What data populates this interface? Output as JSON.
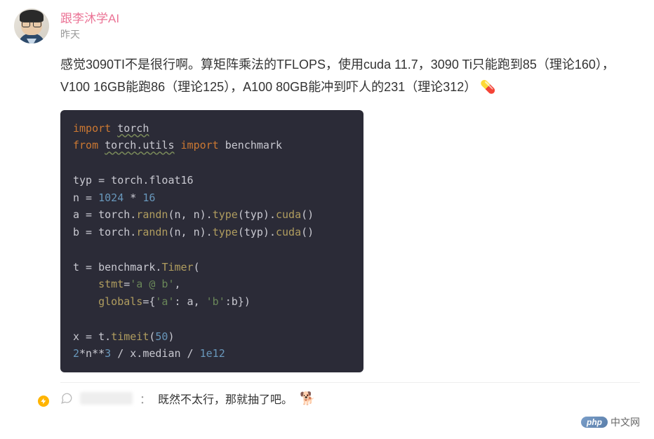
{
  "author": {
    "name": "跟李沐学AI",
    "badge": "verified"
  },
  "timestamp": "昨天",
  "post_text": "感觉3090TI不是很行啊。算矩阵乘法的TFLOPS，使用cuda 11.7，3090 Ti只能跑到85（理论160），V100 16GB能跑86（理论125），A100 80GB能冲到吓人的231（理论312）",
  "pill_emoji": "💊",
  "code": {
    "line1_kw1": "import",
    "line1_mod": "torch",
    "line2_kw1": "from",
    "line2_mod": "torch.utils",
    "line2_kw2": "import",
    "line2_name": "benchmark",
    "line4_var": "typ = torch.float16",
    "line5": "n = ",
    "line5_num1": "1024",
    "line5_op": " * ",
    "line5_num2": "16",
    "line6_pre": "a = torch.",
    "line6_fn": "randn",
    "line6_args": "(n, n).",
    "line6_fn2": "type",
    "line6_args2": "(typ).",
    "line6_fn3": "cuda",
    "line6_end": "()",
    "line7_pre": "b = torch.",
    "line9_pre": "t = benchmark.",
    "line9_fn": "Timer",
    "line9_par": "(",
    "line10_indent": "    ",
    "line10_key": "stmt",
    "line10_eq": "=",
    "line10_str": "'a @ b'",
    "line10_comma": ",",
    "line11_key": "globals",
    "line11_eq": "={",
    "line11_str1": "'a'",
    "line11_mid": ": a, ",
    "line11_str2": "'b'",
    "line11_end": ":b})",
    "line13_pre": "x = t.",
    "line13_fn": "timeit",
    "line13_par": "(",
    "line13_num": "50",
    "line13_end": ")",
    "line14_pre": "",
    "line14_num1": "2",
    "line14_op1": "*n**",
    "line14_num2": "3",
    "line14_op2": " / x.median / ",
    "line14_num3": "1e12"
  },
  "comment": {
    "text": "既然不太行，那就抽了吧。",
    "emoji": "🐕"
  },
  "watermark": {
    "brand": "php",
    "text": "中文网"
  }
}
